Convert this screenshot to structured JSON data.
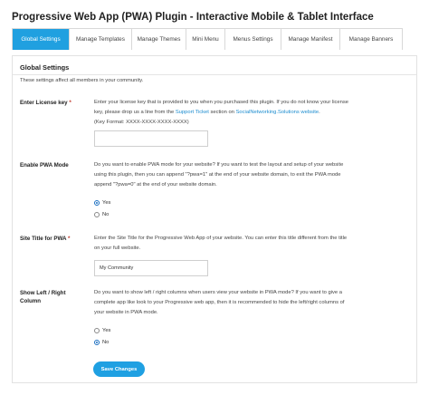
{
  "page": {
    "title": "Progressive Web App (PWA) Plugin - Interactive Mobile & Tablet Interface"
  },
  "tabs": [
    {
      "label": "Global Settings",
      "active": true
    },
    {
      "label": "Manage Templates",
      "active": false
    },
    {
      "label": "Manage Themes",
      "active": false
    },
    {
      "label": "Mini Menu",
      "active": false
    },
    {
      "label": "Menus Settings",
      "active": false
    },
    {
      "label": "Manage Manifest",
      "active": false
    },
    {
      "label": "Manage Banners",
      "active": false
    }
  ],
  "section": {
    "title": "Global Settings",
    "description": "These settings affect all members in your community."
  },
  "license": {
    "label": "Enter License key",
    "required_mark": "*",
    "help_part1": "Enter your license key that is provided to you when you purchased this plugin. If you do not know your license key, please drop us a line from the",
    "link_support": "Support Ticket",
    "help_part2": "section on",
    "link_site": "SocialNetworking.Solutions website",
    "help_part3": ".",
    "format": "(Key Format: XXXX-XXXX-XXXX-XXXX)",
    "value": "",
    "placeholder": ""
  },
  "pwa_mode": {
    "label": "Enable PWA Mode",
    "help": "Do you want to enable PWA mode for your website? If you want to test the layout and setup of your website using this plugin, then you can append \"?pwa=1\" at the end of your website domain, to exit the PWA mode append \"?pwa=0\" at the end of your website domain.",
    "options": [
      {
        "label": "Yes",
        "checked": true
      },
      {
        "label": "No",
        "checked": false
      }
    ]
  },
  "site_title": {
    "label": "Site Title for PWA",
    "required_mark": "*",
    "help": "Enter the Site Title for the Progressive Web App of your website. You can enter this title different from the title on your full website.",
    "value": "My Community"
  },
  "columns": {
    "label": "Show Left / Right Column",
    "help": "Do you want to show left / right columns when users view your website in PWA mode? If you want to give a complete app like look to your Progressive web app, then it is recommended to hide the left/right columns of your website in PWA mode.",
    "options": [
      {
        "label": "Yes",
        "checked": false
      },
      {
        "label": "No",
        "checked": true
      }
    ]
  },
  "actions": {
    "save_label": "Save Changes"
  },
  "colors": {
    "accent": "#20a0e0",
    "link": "#1b8ccf",
    "required": "#c0392b"
  }
}
